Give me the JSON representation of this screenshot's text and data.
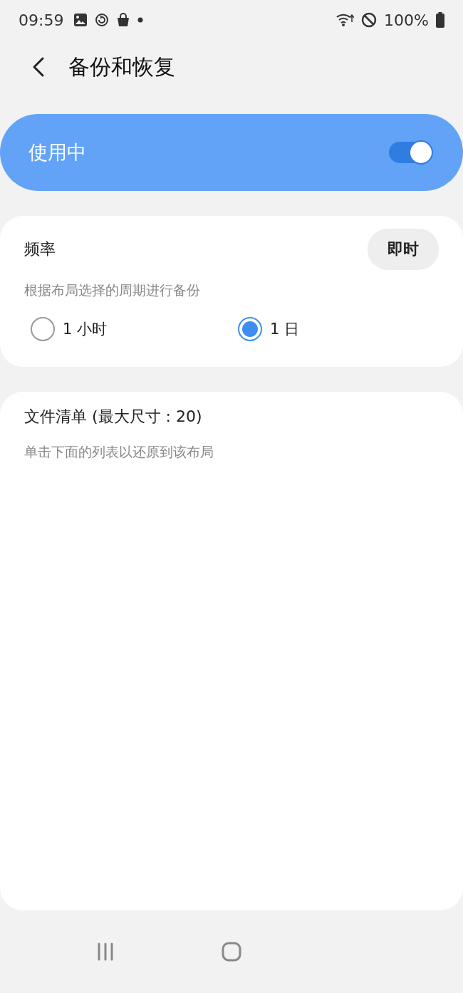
{
  "status_bar": {
    "time": "09:59",
    "battery": "100%"
  },
  "header": {
    "title": "备份和恢复"
  },
  "master_switch": {
    "label": "使用中",
    "on": true
  },
  "frequency": {
    "title": "频率",
    "button": "即时",
    "description": "根据布局选择的周期进行备份",
    "options": [
      {
        "label": "1 小时",
        "selected": false
      },
      {
        "label": "1 日",
        "selected": true
      }
    ]
  },
  "file_list": {
    "title": "文件清单 (最大尺寸 : 20)",
    "description": "单击下面的列表以还原到该布局"
  }
}
